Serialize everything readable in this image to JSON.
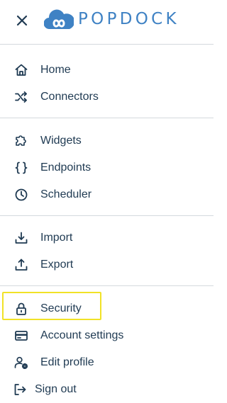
{
  "app": {
    "brand_name": "POPDOCK",
    "brand_color": "#3f82c4",
    "text_color": "#1f3a52",
    "focus_color": "#f1e227"
  },
  "header": {
    "close_icon": "close-icon",
    "logo_icon": "cloud-infinity-logo"
  },
  "nav": {
    "items": [
      {
        "label": "Home",
        "icon": "home-icon"
      },
      {
        "label": "Connectors",
        "icon": "shuffle-icon"
      },
      {
        "label": "Widgets",
        "icon": "puzzle-icon"
      },
      {
        "label": "Endpoints",
        "icon": "braces-icon"
      },
      {
        "label": "Scheduler",
        "icon": "clock-icon"
      },
      {
        "label": "Import",
        "icon": "download-tray-icon"
      },
      {
        "label": "Export",
        "icon": "upload-tray-icon"
      },
      {
        "label": "Security",
        "icon": "lock-icon",
        "focused": true
      },
      {
        "label": "Account settings",
        "icon": "credit-card-icon"
      },
      {
        "label": "Edit profile",
        "icon": "user-gear-icon"
      },
      {
        "label": "Sign out",
        "icon": "sign-out-icon"
      }
    ]
  }
}
